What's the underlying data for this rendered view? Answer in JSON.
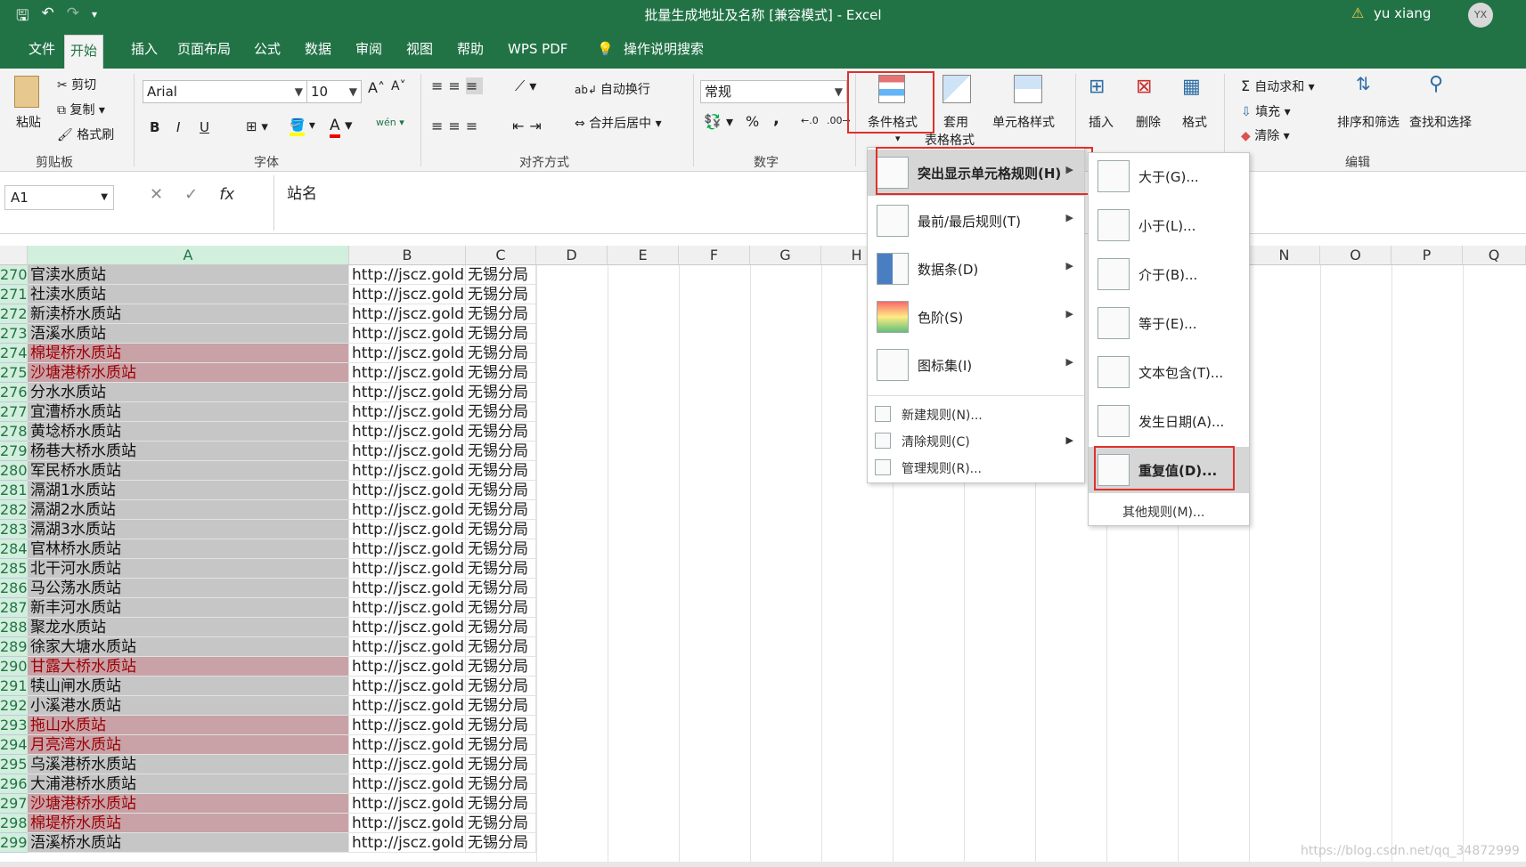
{
  "titlebar": {
    "title": "批量生成地址及名称  [兼容模式]  -  Excel",
    "user": "yu xiang",
    "avatar": "YX"
  },
  "tabs": [
    "文件",
    "开始",
    "插入",
    "页面布局",
    "公式",
    "数据",
    "审阅",
    "视图",
    "帮助",
    "WPS PDF",
    "操作说明搜索"
  ],
  "ribbon": {
    "clipboard": {
      "paste": "粘贴",
      "cut": "剪切",
      "copy": "复制",
      "format_painter": "格式刷",
      "group": "剪贴板"
    },
    "font": {
      "name": "Arial",
      "size": "10",
      "group": "字体",
      "bold": "B",
      "italic": "I",
      "underline": "U",
      "grow": "A",
      "shrink": "A",
      "wen": "wén"
    },
    "alignment": {
      "wrap": "自动换行",
      "merge": "合并后居中",
      "group": "对齐方式"
    },
    "number": {
      "format": "常规",
      "percent": "%",
      "comma": ",",
      "group": "数字"
    },
    "styles": {
      "conditional": "条件格式",
      "table_1": "套用",
      "table_2": "表格格式",
      "cell_styles": "单元格样式"
    },
    "cells": {
      "insert": "插入",
      "delete": "删除",
      "format": "格式"
    },
    "editing": {
      "autosum": "自动求和",
      "fill": "填充",
      "clear": "清除",
      "sort": "排序和筛选",
      "find": "查找和选择",
      "group": "编辑"
    }
  },
  "formula_bar": {
    "name_box": "A1",
    "fx": "fx",
    "content": "站名"
  },
  "columns": [
    "A",
    "B",
    "C",
    "D",
    "E",
    "F",
    "G",
    "H",
    "N",
    "O",
    "P",
    "Q"
  ],
  "rows": [
    {
      "n": "270",
      "a": "官渎水质站",
      "dup": false
    },
    {
      "n": "271",
      "a": "社渎水质站",
      "dup": false
    },
    {
      "n": "272",
      "a": "新渎桥水质站",
      "dup": false
    },
    {
      "n": "273",
      "a": "浯溪水质站",
      "dup": false
    },
    {
      "n": "274",
      "a": "棉堤桥水质站",
      "dup": true
    },
    {
      "n": "275",
      "a": "沙塘港桥水质站",
      "dup": true
    },
    {
      "n": "276",
      "a": "分水水质站",
      "dup": false
    },
    {
      "n": "277",
      "a": "宜漕桥水质站",
      "dup": false
    },
    {
      "n": "278",
      "a": "黄埝桥水质站",
      "dup": false
    },
    {
      "n": "279",
      "a": "杨巷大桥水质站",
      "dup": false
    },
    {
      "n": "280",
      "a": "军民桥水质站",
      "dup": false
    },
    {
      "n": "281",
      "a": "滆湖1水质站",
      "dup": false
    },
    {
      "n": "282",
      "a": "滆湖2水质站",
      "dup": false
    },
    {
      "n": "283",
      "a": "滆湖3水质站",
      "dup": false
    },
    {
      "n": "284",
      "a": "官林桥水质站",
      "dup": false
    },
    {
      "n": "285",
      "a": "北干河水质站",
      "dup": false
    },
    {
      "n": "286",
      "a": "马公荡水质站",
      "dup": false
    },
    {
      "n": "287",
      "a": "新丰河水质站",
      "dup": false
    },
    {
      "n": "288",
      "a": "聚龙水质站",
      "dup": false
    },
    {
      "n": "289",
      "a": "徐家大塘水质站",
      "dup": false
    },
    {
      "n": "290",
      "a": "甘露大桥水质站",
      "dup": true
    },
    {
      "n": "291",
      "a": "犊山闸水质站",
      "dup": false
    },
    {
      "n": "292",
      "a": "小溪港水质站",
      "dup": false
    },
    {
      "n": "293",
      "a": "拖山水质站",
      "dup": true
    },
    {
      "n": "294",
      "a": "月亮湾水质站",
      "dup": true
    },
    {
      "n": "295",
      "a": "乌溪港桥水质站",
      "dup": false
    },
    {
      "n": "296",
      "a": "大浦港桥水质站",
      "dup": false
    },
    {
      "n": "297",
      "a": "沙塘港桥水质站",
      "dup": true
    },
    {
      "n": "298",
      "a": "棉堤桥水质站",
      "dup": true
    },
    {
      "n": "299",
      "a": "浯溪桥水质站",
      "dup": false
    }
  ],
  "cell_b": "http://jscz.goldenw",
  "cell_c": "无锡分局",
  "menu": {
    "highlight_rules": "突出显示单元格规则(H)",
    "top_bottom": "最前/最后规则(T)",
    "data_bars": "数据条(D)",
    "color_scales": "色阶(S)",
    "icon_sets": "图标集(I)",
    "new_rule": "新建规则(N)...",
    "clear_rules": "清除规则(C)",
    "manage_rules": "管理规则(R)..."
  },
  "submenu": {
    "greater": "大于(G)...",
    "less": "小于(L)...",
    "between": "介于(B)...",
    "equal": "等于(E)...",
    "text_contains": "文本包含(T)...",
    "date": "发生日期(A)...",
    "duplicate": "重复值(D)...",
    "more": "其他规则(M)..."
  },
  "watermark": "https://blog.csdn.net/qq_34872999"
}
